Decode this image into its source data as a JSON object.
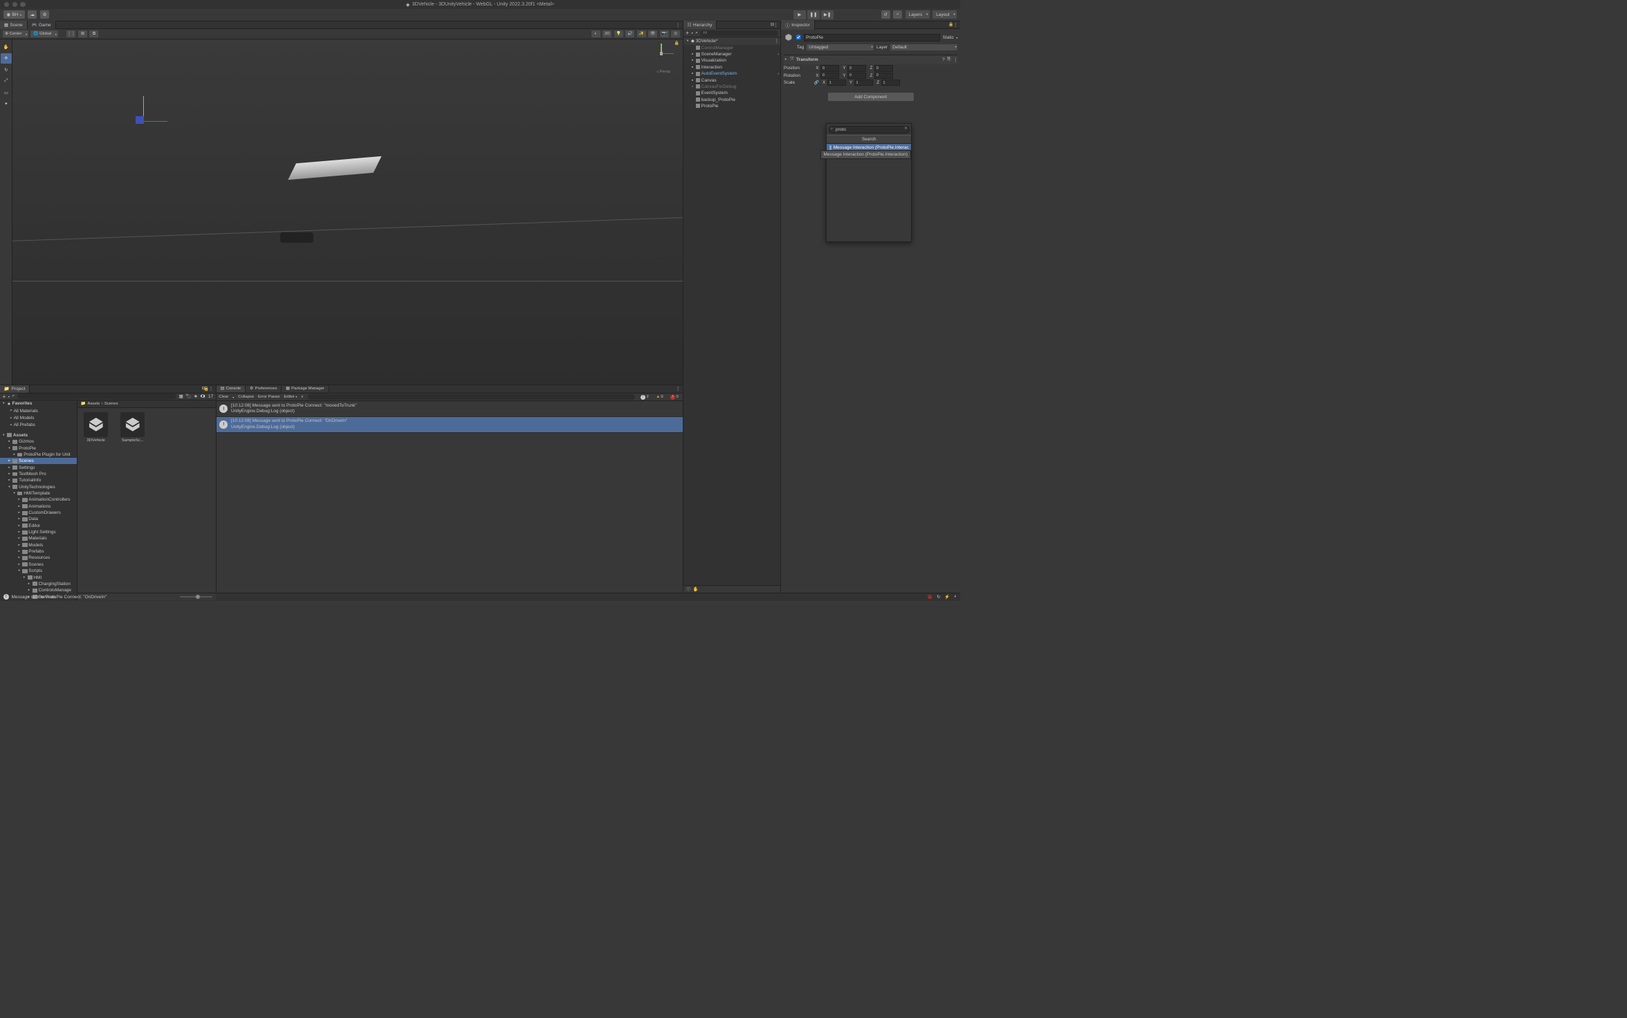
{
  "window": {
    "title": "3DVehicle - 3DUnityVehicle - WebGL - Unity 2022.3.20f1 <Metal>"
  },
  "toolbar": {
    "account": "BH",
    "layers": "Layers",
    "layout": "Layout"
  },
  "tabs": {
    "scene": "Scene",
    "game": "Game",
    "hierarchy": "Hierarchy",
    "inspector": "Inspector",
    "project": "Project",
    "console": "Console",
    "preferences": "Preferences",
    "package_manager": "Package Manager"
  },
  "scene_toolbar": {
    "pivot": "Center",
    "space": "Global",
    "mode_2d": "2D",
    "persp": "Persp"
  },
  "hierarchy": {
    "search_placeholder": "All",
    "scene": "3DVehicle*",
    "items": [
      {
        "name": "ControlManager",
        "disabled": true
      },
      {
        "name": "SceneManager",
        "hasChildren": true
      },
      {
        "name": "Visualization",
        "hasChildren": true
      },
      {
        "name": "Interaction",
        "hasChildren": true
      },
      {
        "name": "AutoEventSystem",
        "hasChildren": true,
        "highlight": true
      },
      {
        "name": "Canvas",
        "hasChildren": true
      },
      {
        "name": "CanvasForDebug",
        "hasChildren": true,
        "disabled": true
      },
      {
        "name": "EventSystem"
      },
      {
        "name": "backup_ProtoPie"
      },
      {
        "name": "ProtoPie"
      }
    ]
  },
  "inspector": {
    "go_name": "ProtoPie",
    "static": "Static",
    "tag_label": "Tag",
    "tag_value": "Untagged",
    "layer_label": "Layer",
    "layer_value": "Default",
    "transform": {
      "title": "Transform",
      "position": {
        "label": "Position",
        "x": "0",
        "y": "0",
        "z": "0"
      },
      "rotation": {
        "label": "Rotation",
        "x": "0",
        "y": "0",
        "z": "0"
      },
      "scale": {
        "label": "Scale",
        "x": "1",
        "y": "1",
        "z": "1"
      }
    },
    "add_component": "Add Component",
    "popup": {
      "search_value": "proto",
      "header": "Search",
      "result_highlight": "Message Interaction (ProtoPie.Interac",
      "tooltip": "Message Interaction (ProtoPie.Interaction)"
    }
  },
  "project": {
    "favorites": "Favorites",
    "fav_items": [
      "All Materials",
      "All Models",
      "All Prefabs"
    ],
    "assets_root": "Assets",
    "tree": [
      {
        "name": "Gizmos",
        "indent": 1
      },
      {
        "name": "ProtoPie",
        "indent": 1,
        "open": true
      },
      {
        "name": "ProtoPie Plugin for Unit",
        "indent": 2
      },
      {
        "name": "Scenes",
        "indent": 1,
        "selected": true
      },
      {
        "name": "Settings",
        "indent": 1
      },
      {
        "name": "TextMesh Pro",
        "indent": 1
      },
      {
        "name": "TutorialInfo",
        "indent": 1
      },
      {
        "name": "UnityTechnologies",
        "indent": 1,
        "open": true
      },
      {
        "name": "HMITemplate",
        "indent": 2,
        "open": true
      },
      {
        "name": "AnimationControllers",
        "indent": 3
      },
      {
        "name": "Animations",
        "indent": 3
      },
      {
        "name": "CustomDrawers",
        "indent": 3
      },
      {
        "name": "Data",
        "indent": 3
      },
      {
        "name": "Editor",
        "indent": 3
      },
      {
        "name": "Light Settings",
        "indent": 3
      },
      {
        "name": "Materials",
        "indent": 3
      },
      {
        "name": "Models",
        "indent": 3
      },
      {
        "name": "Prefabs",
        "indent": 3
      },
      {
        "name": "Resources",
        "indent": 3
      },
      {
        "name": "Scenes",
        "indent": 3
      },
      {
        "name": "Scripts",
        "indent": 3,
        "open": true
      },
      {
        "name": "HMI",
        "indent": 4,
        "open": true
      },
      {
        "name": "ChargingStation",
        "indent": 5
      },
      {
        "name": "ControlsManage",
        "indent": 5
      },
      {
        "name": "Services",
        "indent": 5
      }
    ],
    "breadcrumb": [
      "Assets",
      "Scenes"
    ],
    "grid": [
      "3DVehicle",
      "SampleSc..."
    ],
    "hidden_count": "17"
  },
  "console": {
    "clear": "Clear",
    "collapse": "Collapse",
    "error_pause": "Error Pause",
    "editor": "Editor",
    "counts": {
      "info": "2",
      "warn": "0",
      "error": "0"
    },
    "logs": [
      {
        "time": "[10:12:08]",
        "msg": "Message sent to ProtoPie Connect: \"movedToTrunk\"",
        "trace": "UnityEngine.Debug:Log (object)"
      },
      {
        "time": "[10:12:08]",
        "msg": "Message sent to ProtoPie Connect: \"OnDriveIn\"",
        "trace": "UnityEngine.Debug:Log (object)",
        "selected": true
      }
    ]
  },
  "statusbar": {
    "message": "Message sent to ProtoPie Connect: \"OnDriveIn\""
  }
}
